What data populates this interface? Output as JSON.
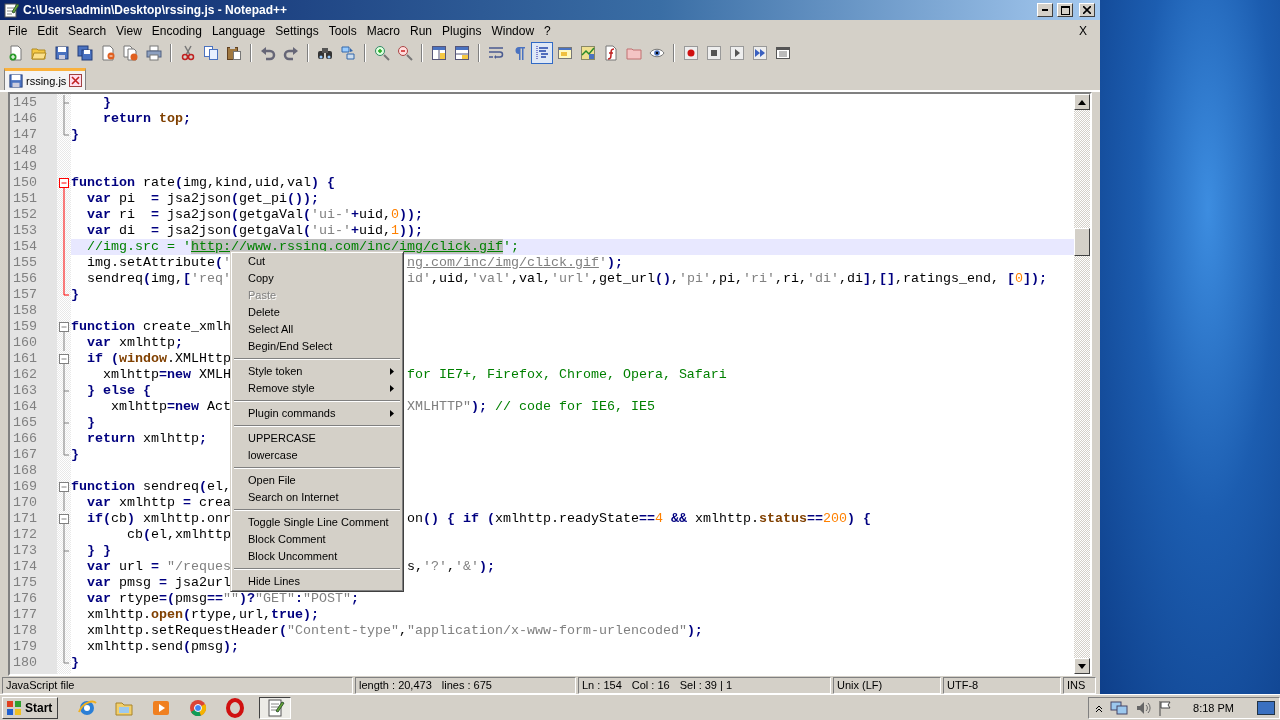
{
  "window": {
    "title": "C:\\Users\\admin\\Desktop\\rssing.js - Notepad++"
  },
  "menu_bar": {
    "items": [
      "File",
      "Edit",
      "Search",
      "View",
      "Encoding",
      "Language",
      "Settings",
      "Tools",
      "Macro",
      "Run",
      "Plugins",
      "Window",
      "?"
    ],
    "close_label": "X"
  },
  "toolbar": {
    "groups": [
      [
        {
          "kind": "new",
          "pressed": false
        },
        {
          "kind": "open",
          "pressed": false
        },
        {
          "kind": "save",
          "pressed": false
        },
        {
          "kind": "save-all",
          "pressed": false
        },
        {
          "kind": "close",
          "pressed": false
        },
        {
          "kind": "close-all",
          "pressed": false
        },
        {
          "kind": "print",
          "pressed": false
        }
      ],
      [
        {
          "kind": "cut",
          "pressed": false
        },
        {
          "kind": "copy",
          "pressed": false
        },
        {
          "kind": "paste",
          "pressed": false
        }
      ],
      [
        {
          "kind": "undo",
          "pressed": false
        },
        {
          "kind": "redo",
          "pressed": false
        }
      ],
      [
        {
          "kind": "find",
          "pressed": false
        },
        {
          "kind": "replace",
          "pressed": false
        }
      ],
      [
        {
          "kind": "zoom-in",
          "pressed": false
        },
        {
          "kind": "zoom-out",
          "pressed": false
        }
      ],
      [
        {
          "kind": "sync-v",
          "pressed": false
        },
        {
          "kind": "sync-h",
          "pressed": false
        }
      ],
      [
        {
          "kind": "wrap",
          "pressed": false
        },
        {
          "kind": "all-chars",
          "pressed": false
        },
        {
          "kind": "indent-guide",
          "pressed": true
        },
        {
          "kind": "panel",
          "pressed": false
        },
        {
          "kind": "doc-map",
          "pressed": false
        },
        {
          "kind": "function-list",
          "pressed": false
        },
        {
          "kind": "folder-workspace",
          "pressed": false
        },
        {
          "kind": "monitor",
          "pressed": false
        }
      ],
      [
        {
          "kind": "record",
          "pressed": false
        },
        {
          "kind": "stop",
          "pressed": false
        },
        {
          "kind": "play",
          "pressed": false
        },
        {
          "kind": "run-multi",
          "pressed": false
        },
        {
          "kind": "save-macro",
          "pressed": false
        }
      ]
    ]
  },
  "tabs": [
    {
      "label": "rssing.js",
      "selected": true
    }
  ],
  "editor": {
    "lines": [
      {
        "number": "145",
        "kind": "fold-mid",
        "fold_active": false,
        "current": false,
        "tokens": [
          {
            "kind": "op",
            "text": "    }"
          }
        ]
      },
      {
        "number": "146",
        "kind": "fold-body",
        "fold_active": false,
        "current": false,
        "tokens": [
          {
            "kind": "kw",
            "text": "    return"
          },
          {
            "kind": "special",
            "text": " top"
          },
          {
            "kind": "op",
            "text": ";"
          }
        ]
      },
      {
        "number": "147",
        "kind": "fold-end",
        "fold_active": false,
        "current": false,
        "tokens": [
          {
            "kind": "op",
            "text": "}"
          }
        ]
      },
      {
        "number": "148",
        "kind": "plain",
        "current": false
      },
      {
        "number": "149",
        "kind": "plain",
        "current": false
      },
      {
        "number": "150",
        "kind": "fold-start",
        "fold_active": true,
        "current": false,
        "tokens": [
          {
            "kind": "kw",
            "text": "function"
          },
          {
            "kind": "plain",
            "text": " rate"
          },
          {
            "kind": "op",
            "text": "("
          },
          {
            "kind": "plain",
            "text": "img,kind,uid,val"
          },
          {
            "kind": "op",
            "text": ")"
          },
          {
            "kind": "op",
            "text": " {"
          }
        ]
      },
      {
        "number": "151",
        "kind": "fold-body",
        "fold_active": true,
        "current": false,
        "tokens": [
          {
            "kind": "kw",
            "text": "  var"
          },
          {
            "kind": "plain",
            "text": " pi  "
          },
          {
            "kind": "op",
            "text": "="
          },
          {
            "kind": "plain",
            "text": " jsa2json"
          },
          {
            "kind": "op",
            "text": "("
          },
          {
            "kind": "plain",
            "text": "get_pi"
          },
          {
            "kind": "op",
            "text": "());"
          }
        ]
      },
      {
        "number": "152",
        "kind": "fold-body",
        "fold_active": true,
        "current": false,
        "tokens": [
          {
            "kind": "kw",
            "text": "  var"
          },
          {
            "kind": "plain",
            "text": " ri  "
          },
          {
            "kind": "op",
            "text": "="
          },
          {
            "kind": "plain",
            "text": " jsa2json"
          },
          {
            "kind": "op",
            "text": "("
          },
          {
            "kind": "plain",
            "text": "getgaVal"
          },
          {
            "kind": "op",
            "text": "("
          },
          {
            "kind": "str",
            "text": "'ui-'"
          },
          {
            "kind": "op",
            "text": "+"
          },
          {
            "kind": "plain",
            "text": "uid,"
          },
          {
            "kind": "num",
            "text": "0"
          },
          {
            "kind": "op",
            "text": "));"
          }
        ]
      },
      {
        "number": "153",
        "kind": "fold-body",
        "fold_active": true,
        "current": false,
        "tokens": [
          {
            "kind": "kw",
            "text": "  var"
          },
          {
            "kind": "plain",
            "text": " di  "
          },
          {
            "kind": "op",
            "text": "="
          },
          {
            "kind": "plain",
            "text": " jsa2json"
          },
          {
            "kind": "op",
            "text": "("
          },
          {
            "kind": "plain",
            "text": "getgaVal"
          },
          {
            "kind": "op",
            "text": "("
          },
          {
            "kind": "str",
            "text": "'ui-'"
          },
          {
            "kind": "op",
            "text": "+"
          },
          {
            "kind": "plain",
            "text": "uid,"
          },
          {
            "kind": "num",
            "text": "1"
          },
          {
            "kind": "op",
            "text": "));"
          }
        ]
      },
      {
        "number": "154",
        "kind": "fold-body",
        "fold_active": true,
        "current": true,
        "tokens": [
          {
            "kind": "cmt",
            "text": "  //img.src = '"
          },
          {
            "kind": "selected-link",
            "text": "http://www.rssing.com/inc/img/click.gif"
          },
          {
            "kind": "cmt",
            "text": "';"
          }
        ]
      },
      {
        "number": "155",
        "kind": "fold-body",
        "fold_active": true,
        "current": false,
        "tokens": [
          {
            "kind": "plain",
            "text": "  img.setAttribute"
          },
          {
            "kind": "op",
            "text": "("
          },
          {
            "kind": "str",
            "text": "'"
          }
        ],
        "after_menu": [
          {
            "kind": "string-link",
            "text": "ng.com/inc/img/click.gif"
          },
          {
            "kind": "str",
            "text": "'"
          },
          {
            "kind": "op",
            "text": ");"
          }
        ]
      },
      {
        "number": "156",
        "kind": "fold-body",
        "fold_active": true,
        "current": false,
        "tokens": [
          {
            "kind": "plain",
            "text": "  sendreq"
          },
          {
            "kind": "op",
            "text": "("
          },
          {
            "kind": "plain",
            "text": "img,"
          },
          {
            "kind": "op",
            "text": "["
          },
          {
            "kind": "str",
            "text": "'req'"
          }
        ],
        "after_menu": [
          {
            "kind": "str",
            "text": "id'"
          },
          {
            "kind": "plain",
            "text": ",uid,"
          },
          {
            "kind": "str",
            "text": "'val'"
          },
          {
            "kind": "plain",
            "text": ",val,"
          },
          {
            "kind": "str",
            "text": "'url'"
          },
          {
            "kind": "plain",
            "text": ",get_url"
          },
          {
            "kind": "op",
            "text": "()"
          },
          {
            "kind": "plain",
            "text": ","
          },
          {
            "kind": "str",
            "text": "'pi'"
          },
          {
            "kind": "plain",
            "text": ",pi,"
          },
          {
            "kind": "str",
            "text": "'ri'"
          },
          {
            "kind": "plain",
            "text": ",ri,"
          },
          {
            "kind": "str",
            "text": "'di'"
          },
          {
            "kind": "plain",
            "text": ",di"
          },
          {
            "kind": "op",
            "text": "]"
          },
          {
            "kind": "plain",
            "text": ","
          },
          {
            "kind": "op",
            "text": "[]"
          },
          {
            "kind": "plain",
            "text": ",ratings_end, "
          },
          {
            "kind": "op",
            "text": "["
          },
          {
            "kind": "num",
            "text": "0"
          },
          {
            "kind": "op",
            "text": "]);"
          }
        ]
      },
      {
        "number": "157",
        "kind": "fold-end",
        "fold_active": true,
        "current": false,
        "tokens": [
          {
            "kind": "op",
            "text": "}"
          }
        ]
      },
      {
        "number": "158",
        "kind": "plain",
        "current": false
      },
      {
        "number": "159",
        "kind": "fold-start",
        "fold_active": false,
        "current": false,
        "tokens": [
          {
            "kind": "kw",
            "text": "function"
          },
          {
            "kind": "plain",
            "text": " create_xmlh"
          }
        ]
      },
      {
        "number": "160",
        "kind": "fold-body",
        "fold_active": false,
        "current": false,
        "tokens": [
          {
            "kind": "kw",
            "text": "  var"
          },
          {
            "kind": "plain",
            "text": " xmlhttp"
          },
          {
            "kind": "op",
            "text": ";"
          }
        ]
      },
      {
        "number": "161",
        "kind": "fold-start",
        "fold_active": false,
        "current": false,
        "tokens": [
          {
            "kind": "kw",
            "text": "  if"
          },
          {
            "kind": "op",
            "text": " ("
          },
          {
            "kind": "special",
            "text": "window"
          },
          {
            "kind": "plain",
            "text": ".XMLHttp"
          }
        ]
      },
      {
        "number": "162",
        "kind": "fold-body",
        "fold_active": false,
        "current": false,
        "tokens": [
          {
            "kind": "plain",
            "text": "    xmlhttp"
          },
          {
            "kind": "op",
            "text": "="
          },
          {
            "kind": "kw",
            "text": "new"
          },
          {
            "kind": "plain",
            "text": " XMLH"
          }
        ],
        "after_menu": [
          {
            "kind": "cmt",
            "text": "for IE7+, Firefox, Chrome, Opera, Safari"
          }
        ]
      },
      {
        "number": "163",
        "kind": "fold-mid",
        "fold_active": false,
        "current": false,
        "tokens": [
          {
            "kind": "op",
            "text": "  }"
          },
          {
            "kind": "kw",
            "text": " else"
          },
          {
            "kind": "op",
            "text": " {"
          }
        ]
      },
      {
        "number": "164",
        "kind": "fold-body",
        "fold_active": false,
        "current": false,
        "tokens": [
          {
            "kind": "plain",
            "text": "     xmlhttp"
          },
          {
            "kind": "op",
            "text": "="
          },
          {
            "kind": "kw",
            "text": "new"
          },
          {
            "kind": "plain",
            "text": " Act"
          }
        ],
        "after_menu": [
          {
            "kind": "str",
            "text": "XMLHTTP\""
          },
          {
            "kind": "op",
            "text": ");"
          },
          {
            "kind": "cmt",
            "text": " // code for IE6, IE5"
          }
        ]
      },
      {
        "number": "165",
        "kind": "fold-mid",
        "fold_active": false,
        "current": false,
        "tokens": [
          {
            "kind": "op",
            "text": "  }"
          }
        ]
      },
      {
        "number": "166",
        "kind": "fold-body",
        "fold_active": false,
        "current": false,
        "tokens": [
          {
            "kind": "kw",
            "text": "  return"
          },
          {
            "kind": "plain",
            "text": " xmlhttp"
          },
          {
            "kind": "op",
            "text": ";"
          }
        ]
      },
      {
        "number": "167",
        "kind": "fold-end",
        "fold_active": false,
        "current": false,
        "tokens": [
          {
            "kind": "op",
            "text": "}"
          }
        ]
      },
      {
        "number": "168",
        "kind": "plain",
        "current": false
      },
      {
        "number": "169",
        "kind": "fold-start",
        "fold_active": false,
        "current": false,
        "tokens": [
          {
            "kind": "kw",
            "text": "function"
          },
          {
            "kind": "plain",
            "text": " sendreq"
          },
          {
            "kind": "op",
            "text": "("
          },
          {
            "kind": "plain",
            "text": "el,"
          }
        ]
      },
      {
        "number": "170",
        "kind": "fold-body",
        "fold_active": false,
        "current": false,
        "tokens": [
          {
            "kind": "kw",
            "text": "  var"
          },
          {
            "kind": "plain",
            "text": " xmlhttp "
          },
          {
            "kind": "op",
            "text": "="
          },
          {
            "kind": "plain",
            "text": " crea"
          }
        ]
      },
      {
        "number": "171",
        "kind": "fold-start",
        "fold_active": false,
        "current": false,
        "tokens": [
          {
            "kind": "kw",
            "text": "  if"
          },
          {
            "kind": "op",
            "text": "("
          },
          {
            "kind": "plain",
            "text": "cb"
          },
          {
            "kind": "op",
            "text": ")"
          },
          {
            "kind": "plain",
            "text": " xmlhttp.onr"
          }
        ],
        "after_menu": [
          {
            "kind": "plain",
            "text": "on"
          },
          {
            "kind": "op",
            "text": "()"
          },
          {
            "kind": "op",
            "text": " {"
          },
          {
            "kind": "kw",
            "text": " if"
          },
          {
            "kind": "op",
            "text": " ("
          },
          {
            "kind": "plain",
            "text": "xmlhttp.readyState"
          },
          {
            "kind": "op",
            "text": "=="
          },
          {
            "kind": "num",
            "text": "4"
          },
          {
            "kind": "op",
            "text": " &&"
          },
          {
            "kind": "plain",
            "text": " xmlhttp."
          },
          {
            "kind": "special",
            "text": "status"
          },
          {
            "kind": "op",
            "text": "=="
          },
          {
            "kind": "num",
            "text": "200"
          },
          {
            "kind": "op",
            "text": ")"
          },
          {
            "kind": "op",
            "text": " {"
          }
        ]
      },
      {
        "number": "172",
        "kind": "fold-body",
        "fold_active": false,
        "current": false,
        "tokens": [
          {
            "kind": "plain",
            "text": "       cb"
          },
          {
            "kind": "op",
            "text": "("
          },
          {
            "kind": "plain",
            "text": "el,xmlhttp"
          }
        ]
      },
      {
        "number": "173",
        "kind": "fold-mid",
        "fold_active": false,
        "current": false,
        "tokens": [
          {
            "kind": "op",
            "text": "  }"
          },
          {
            "kind": "op",
            "text": " }"
          }
        ]
      },
      {
        "number": "174",
        "kind": "fold-body",
        "fold_active": false,
        "current": false,
        "tokens": [
          {
            "kind": "kw",
            "text": "  var"
          },
          {
            "kind": "plain",
            "text": " url "
          },
          {
            "kind": "op",
            "text": "="
          },
          {
            "kind": "str",
            "text": " \"/reques"
          }
        ],
        "after_menu": [
          {
            "kind": "plain",
            "text": "s,"
          },
          {
            "kind": "str",
            "text": "'?'"
          },
          {
            "kind": "plain",
            "text": ","
          },
          {
            "kind": "str",
            "text": "'&'"
          },
          {
            "kind": "op",
            "text": ");"
          }
        ]
      },
      {
        "number": "175",
        "kind": "fold-body",
        "fold_active": false,
        "current": false,
        "tokens": [
          {
            "kind": "kw",
            "text": "  var"
          },
          {
            "kind": "plain",
            "text": " pmsg "
          },
          {
            "kind": "op",
            "text": "="
          },
          {
            "kind": "plain",
            "text": " jsa2url"
          }
        ]
      },
      {
        "number": "176",
        "kind": "fold-body",
        "fold_active": false,
        "current": false,
        "tokens": [
          {
            "kind": "kw",
            "text": "  var"
          },
          {
            "kind": "plain",
            "text": " rtype"
          },
          {
            "kind": "op",
            "text": "=("
          },
          {
            "kind": "plain",
            "text": "pmsg"
          },
          {
            "kind": "op",
            "text": "=="
          },
          {
            "kind": "str",
            "text": "\"\""
          },
          {
            "kind": "op",
            "text": ")?"
          },
          {
            "kind": "str",
            "text": "\"GET\""
          },
          {
            "kind": "op",
            "text": ":"
          },
          {
            "kind": "str",
            "text": "\"POST\""
          },
          {
            "kind": "op",
            "text": ";"
          }
        ]
      },
      {
        "number": "177",
        "kind": "fold-body",
        "fold_active": false,
        "current": false,
        "tokens": [
          {
            "kind": "plain",
            "text": "  xmlhttp."
          },
          {
            "kind": "special",
            "text": "open"
          },
          {
            "kind": "op",
            "text": "("
          },
          {
            "kind": "plain",
            "text": "rtype,url,"
          },
          {
            "kind": "kw",
            "text": "true"
          },
          {
            "kind": "op",
            "text": ");"
          }
        ]
      },
      {
        "number": "178",
        "kind": "fold-body",
        "fold_active": false,
        "current": false,
        "tokens": [
          {
            "kind": "plain",
            "text": "  xmlhttp.setRequestHeader"
          },
          {
            "kind": "op",
            "text": "("
          },
          {
            "kind": "str",
            "text": "\"Content-type\""
          },
          {
            "kind": "plain",
            "text": ","
          },
          {
            "kind": "str",
            "text": "\"application/x-www-form-urlencoded\""
          },
          {
            "kind": "op",
            "text": ");"
          }
        ]
      },
      {
        "number": "179",
        "kind": "fold-body",
        "fold_active": false,
        "current": false,
        "tokens": [
          {
            "kind": "plain",
            "text": "  xmlhttp.send"
          },
          {
            "kind": "op",
            "text": "("
          },
          {
            "kind": "plain",
            "text": "pmsg"
          },
          {
            "kind": "op",
            "text": ");"
          }
        ]
      },
      {
        "number": "180",
        "kind": "fold-end",
        "fold_active": false,
        "current": false,
        "tokens": [
          {
            "kind": "op",
            "text": "}"
          }
        ]
      }
    ]
  },
  "context_menu": {
    "items": [
      {
        "kind": "item",
        "label": "Cut",
        "disabled": false,
        "submenu": false
      },
      {
        "kind": "item",
        "label": "Copy",
        "disabled": false,
        "submenu": false
      },
      {
        "kind": "item",
        "label": "Paste",
        "disabled": true,
        "submenu": false
      },
      {
        "kind": "item",
        "label": "Delete",
        "disabled": false,
        "submenu": false
      },
      {
        "kind": "item",
        "label": "Select All",
        "disabled": false,
        "submenu": false
      },
      {
        "kind": "item",
        "label": "Begin/End Select",
        "disabled": false,
        "submenu": false
      },
      {
        "kind": "separator"
      },
      {
        "kind": "item",
        "label": "Style token",
        "disabled": false,
        "submenu": true
      },
      {
        "kind": "item",
        "label": "Remove style",
        "disabled": false,
        "submenu": true
      },
      {
        "kind": "separator"
      },
      {
        "kind": "item",
        "label": "Plugin commands",
        "disabled": false,
        "submenu": true
      },
      {
        "kind": "separator"
      },
      {
        "kind": "item",
        "label": "UPPERCASE",
        "disabled": false,
        "submenu": false
      },
      {
        "kind": "item",
        "label": "lowercase",
        "disabled": false,
        "submenu": false
      },
      {
        "kind": "separator"
      },
      {
        "kind": "item",
        "label": "Open File",
        "disabled": false,
        "submenu": false
      },
      {
        "kind": "item",
        "label": "Search on Internet",
        "disabled": false,
        "submenu": false
      },
      {
        "kind": "separator"
      },
      {
        "kind": "item",
        "label": "Toggle Single Line Comment",
        "disabled": false,
        "submenu": false
      },
      {
        "kind": "item",
        "label": "Block Comment",
        "disabled": false,
        "submenu": false
      },
      {
        "kind": "item",
        "label": "Block Uncomment",
        "disabled": false,
        "submenu": false
      },
      {
        "kind": "separator"
      },
      {
        "kind": "item",
        "label": "Hide Lines",
        "disabled": false,
        "submenu": false
      }
    ]
  },
  "status_bar": {
    "file_type": "JavaScript file",
    "length": "length : 20,473",
    "lines": "lines : 675",
    "ln": "Ln : 154",
    "col": "Col : 16",
    "sel": "Sel : 39 | 1",
    "eol": "Unix (LF)",
    "encoding": "UTF-8",
    "mode": "INS"
  },
  "taskbar": {
    "start": "Start",
    "apps": [
      {
        "kind": "ie",
        "active": false
      },
      {
        "kind": "explorer",
        "active": false
      },
      {
        "kind": "media",
        "active": false
      },
      {
        "kind": "chrome",
        "active": false
      },
      {
        "kind": "opera",
        "active": false
      },
      {
        "kind": "notepad",
        "active": true
      }
    ],
    "clock": "8:18 PM"
  }
}
